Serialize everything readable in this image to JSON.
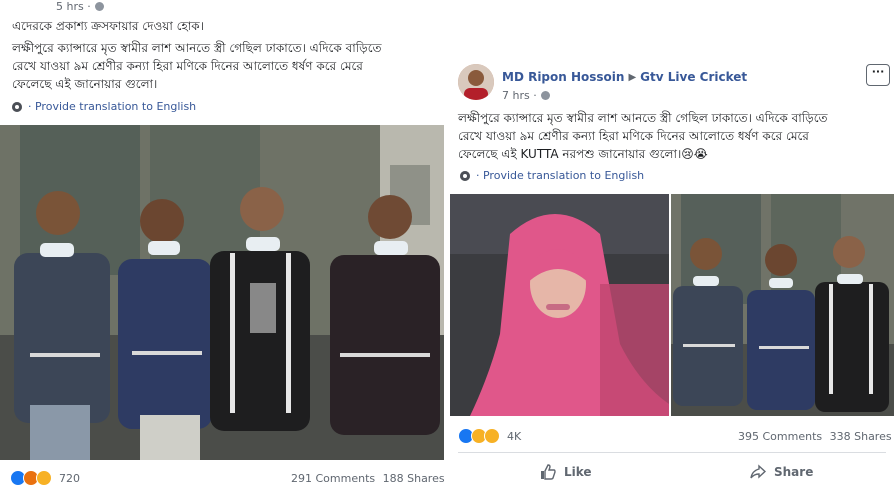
{
  "left_post": {
    "time": "5 hrs ·",
    "text_line1": "এদেরকে প্রকাশ্য ক্রসফায়ার দেওয়া হোক।",
    "text_line2": "লক্ষীপুরে ক্যান্সারে মৃত স্বামীর লাশ আনতে স্ত্রী গেছিল ঢাকাতে। এদিকে বাড়িতে",
    "text_line3": "রেখে যাওয়া ৯ম শ্রেণীর কন্যা হিরা মণিকে দিনের আলোতে ধর্ষণ করে মেরে",
    "text_line4": "ফেলেছে এই জানোয়ার গুলো।",
    "translate": "· Provide translation to English",
    "reaction_count": "720",
    "comments": "291 Comments",
    "shares": "188 Shares"
  },
  "right_post": {
    "author": "MD Ripon Hossoin",
    "arrow": "▶",
    "page": "Gtv Live Cricket",
    "time": "7 hrs ·",
    "more": "···",
    "text_line1": "লক্ষীপুরে ক্যান্সারে মৃত স্বামীর লাশ আনতে স্ত্রী গেছিল ঢাকাতে। এদিকে বাড়িতে",
    "text_line2": "রেখে যাওয়া ৯ম শ্রেণীর কন্যা হিরা মণিকে দিনের আলোতে ধর্ষণ করে মেরে",
    "text_line3": "ফেলেছে এই KUTTA নরপশু জানোয়ার গুলো।😢😭",
    "translate": "· Provide translation to English",
    "reaction_count": "4K",
    "comments": "395 Comments",
    "shares": "338 Shares",
    "like_label": "Like",
    "share_label": "Share"
  },
  "icons": {
    "globe": "globe-icon",
    "translate": "gear-icon",
    "like": "thumbs-up-icon",
    "share": "share-arrow-icon"
  }
}
